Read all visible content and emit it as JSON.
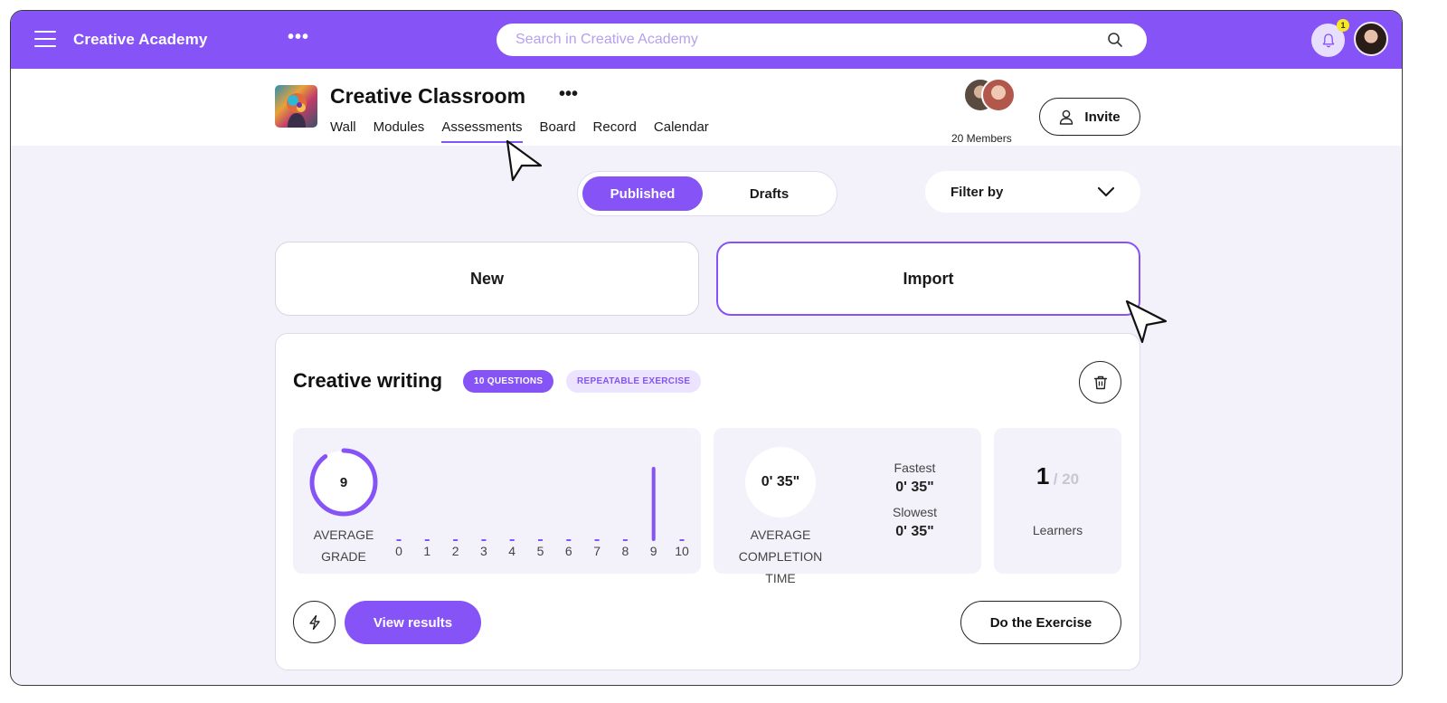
{
  "topbar": {
    "brand": "Creative Academy",
    "more_label": "•••",
    "search_placeholder": "Search in Creative Academy",
    "notification_count": "1"
  },
  "class": {
    "title": "Creative Classroom",
    "more_label": "•••",
    "tabs": [
      {
        "label": "Wall"
      },
      {
        "label": "Modules"
      },
      {
        "label": "Assessments",
        "active": true
      },
      {
        "label": "Board"
      },
      {
        "label": "Record"
      },
      {
        "label": "Calendar"
      }
    ],
    "members_label": "20 Members",
    "invite_label": "Invite"
  },
  "filters": {
    "published_label": "Published",
    "drafts_label": "Drafts",
    "active": "Published",
    "filter_label": "Filter by"
  },
  "actions": {
    "new_label": "New",
    "import_label": "Import"
  },
  "assessment": {
    "title": "Creative writing",
    "questions_badge": "10 QUESTIONS",
    "repeatable_badge": "REPEATABLE EXERCISE",
    "average_grade": "9",
    "average_grade_label_1": "AVERAGE",
    "average_grade_label_2": "GRADE",
    "grade_distribution": {
      "labels": [
        "0",
        "1",
        "2",
        "3",
        "4",
        "5",
        "6",
        "7",
        "8",
        "9",
        "10"
      ],
      "counts": [
        0,
        0,
        0,
        0,
        0,
        0,
        0,
        0,
        0,
        1,
        0
      ]
    },
    "average_time": "0' 35\"",
    "average_time_label_1": "AVERAGE",
    "average_time_label_2": "COMPLETION",
    "average_time_label_3": "TIME",
    "fastest_label": "Fastest",
    "fastest_value": "0' 35\"",
    "slowest_label": "Slowest",
    "slowest_value": "0' 35\"",
    "learners_done": "1",
    "learners_total": "/ 20",
    "learners_label": "Learners",
    "view_results_label": "View results",
    "do_exercise_label": "Do the Exercise"
  },
  "colors": {
    "accent": "#8553f6",
    "accent_light": "#ece4fe",
    "panel_bg": "#f3f2fa",
    "badge_yellow": "#f7e81f"
  },
  "icons": {
    "menu": "hamburger-icon",
    "search": "search-icon",
    "notifications": "bell-icon",
    "invite": "user-icon",
    "filter": "chevron-down-icon",
    "delete": "trash-icon",
    "quick": "lightning-icon"
  }
}
